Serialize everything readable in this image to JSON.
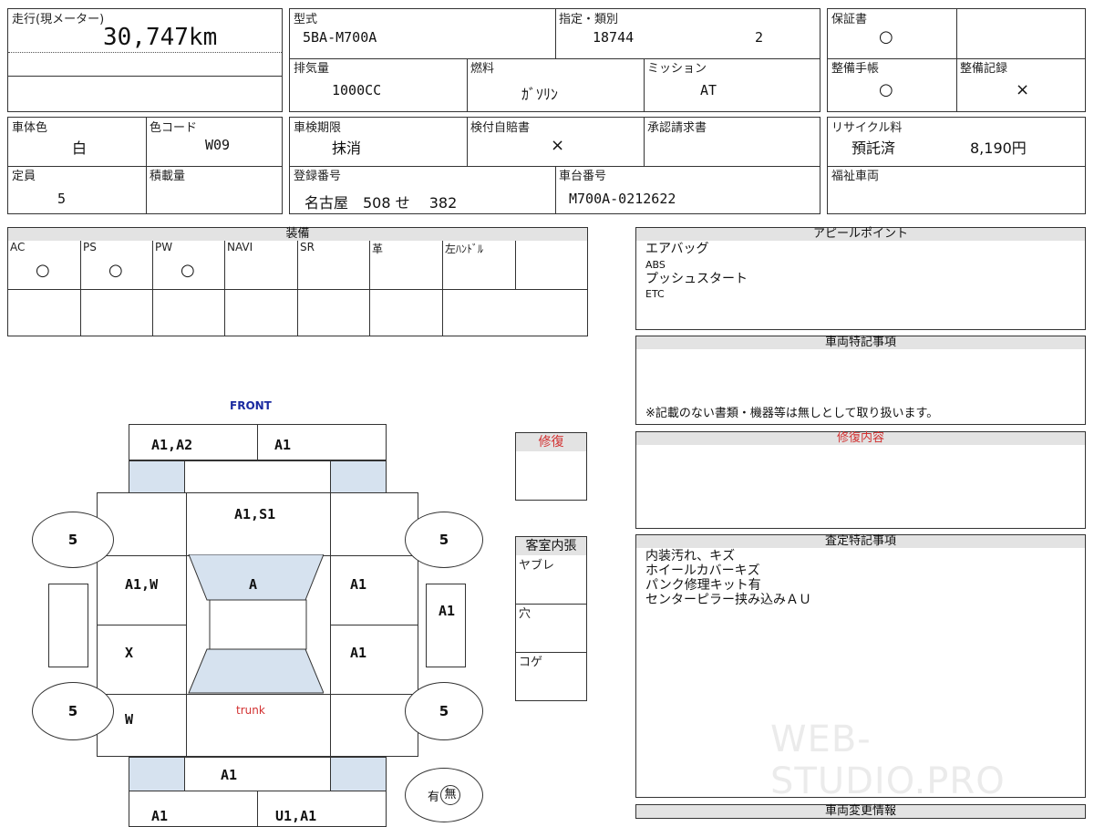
{
  "odometer": {
    "label": "走行(現メーター)",
    "value": "30,747km"
  },
  "model": {
    "label": "型式",
    "value": "5BA-M700A"
  },
  "designation": {
    "label": "指定・類別",
    "number": "18744",
    "class": "2"
  },
  "warranty": {
    "label": "保証書",
    "value": "○"
  },
  "displacement": {
    "label": "排気量",
    "value": "1000CC"
  },
  "fuel": {
    "label": "燃料",
    "value": "ｶﾞｿﾘﾝ"
  },
  "transmission": {
    "label": "ミッション",
    "value": "AT"
  },
  "maint_book": {
    "label": "整備手帳",
    "value": "○"
  },
  "maint_record": {
    "label": "整備記録",
    "value": "×"
  },
  "body_color": {
    "label": "車体色",
    "value": "白"
  },
  "color_code": {
    "label": "色コード",
    "value": "W09"
  },
  "inspection": {
    "label": "車検期限",
    "value": "抹消"
  },
  "insurance": {
    "label": "検付自賠書",
    "value": "×"
  },
  "approval": {
    "label": "承認請求書"
  },
  "recycle": {
    "label": "リサイクル料",
    "status": "預託済",
    "amount": "8,190円"
  },
  "capacity": {
    "label": "定員",
    "value": "5"
  },
  "load": {
    "label": "積載量"
  },
  "registration": {
    "label": "登録番号",
    "value": "名古屋　508 せ　 382"
  },
  "chassis": {
    "label": "車台番号",
    "value": "M700A-0212622"
  },
  "welfare": {
    "label": "福祉車両"
  },
  "equipment": {
    "title": "装備",
    "items": [
      {
        "label": "AC",
        "mark": "○"
      },
      {
        "label": "PS",
        "mark": "○"
      },
      {
        "label": "PW",
        "mark": "○"
      },
      {
        "label": "NAVI",
        "mark": ""
      },
      {
        "label": "SR",
        "mark": ""
      },
      {
        "label": "革",
        "mark": ""
      },
      {
        "label": "左ﾊﾝﾄﾞﾙ",
        "mark": ""
      }
    ]
  },
  "appeal": {
    "title": "アピールポイント",
    "lines": [
      "エアバッグ",
      "ABS",
      "プッシュスタート",
      "ETC"
    ]
  },
  "vehicle_notes": {
    "title": "車両特記事項",
    "footer": "※記載のない書類・機器等は無しとして取り扱います。"
  },
  "repair_content": {
    "title": "修復内容"
  },
  "assessment": {
    "title": "査定特記事項",
    "lines": [
      "内装汚れ、キズ",
      "ホイールカバーキズ",
      "パンク修理キット有",
      "センターピラー挟み込みＡＵ"
    ]
  },
  "changes": {
    "title": "車両変更情報"
  },
  "repair_box": {
    "title": "修復"
  },
  "interior": {
    "title": "客室内張",
    "rows": [
      "ヤブレ",
      "穴",
      "コゲ"
    ]
  },
  "diagram": {
    "front": "FRONT",
    "trunk": "trunk",
    "front_left": "A1,A2",
    "front_right": "A1",
    "bonnet": "A1,S1",
    "left_front_door": "A1,W",
    "windshield": "A",
    "right_front_door": "A1",
    "left_rear_door": "X",
    "right_rear_door": "A1",
    "left_rear": "W",
    "right_side": "A1",
    "rear": "A1",
    "rear_left": "A1",
    "rear_right": "U1,A1",
    "tire_fl": "5",
    "tire_fr": "5",
    "tire_rl": "5",
    "tire_rr": "5",
    "spare_have": "有",
    "spare_none": "無"
  },
  "watermark": "WEB-STUDIO.PRO"
}
